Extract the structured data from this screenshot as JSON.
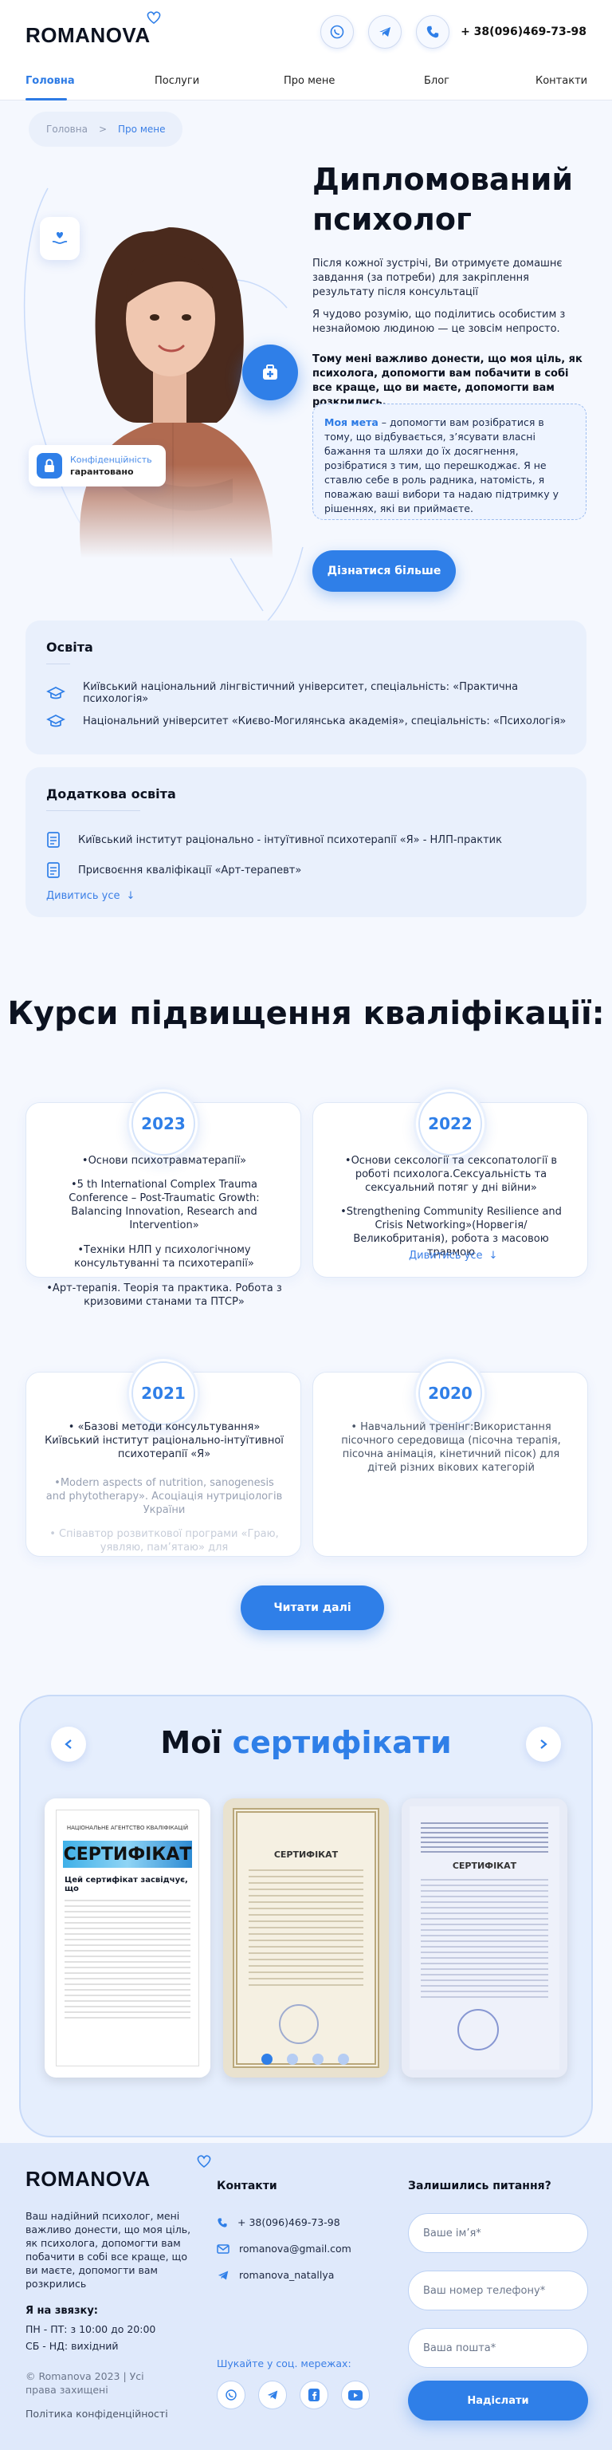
{
  "header": {
    "logo": "ROMANOVA",
    "phone": "+ 38(096)469-73-98",
    "icons": [
      "viber-icon",
      "telegram-icon",
      "phone-icon"
    ]
  },
  "nav": {
    "items": [
      "Головна",
      "Послуги",
      "Про мене",
      "Блог",
      "Контакти"
    ],
    "active": "Головна"
  },
  "breadcrumb": {
    "home": "Головна",
    "sep": ">",
    "current": "Про мене"
  },
  "hero": {
    "title": "Дипломований психолог",
    "p1": "Після кожної зустрічі, Ви отримуєте домашнє завдання (за потреби) для закріплення результату після консультації",
    "p2": "Я чудово розумію, що поділитись особистим з незнайомою людиною — це зовсім непросто.",
    "bold": "Тому мені важливо донести, що моя ціль, як психолога, допомогти вам побачити в собі все краще, що ви маєте, допомогти вам розкрились.",
    "goal_label": "Моя мета",
    "goal_text": " – допомогти вам розібратися в тому, що відбувається, з’ясувати власні бажання та шляхи до їх досягнення, розібратися з тим, що перешкоджає. Я не ставлю себе в роль радника, натомість, я поважаю ваші вибори та надаю підтримку у рішеннях, які ви приймаєте.",
    "badge_line1": "Конфіденційність",
    "badge_line2": "гарантовано",
    "cta": "Дізнатися більше"
  },
  "education": {
    "title": "Освіта",
    "items": [
      "Київський національний лінгвістичний університет, спеціальність: «Практична психологія»",
      "Національний університет «Києво-Могилянська академія», спеціальність: «Психологія»"
    ]
  },
  "extra": {
    "title": "Додаткова освіта",
    "items": [
      "Київський інститут раціонально - інтуїтивної психотерапії «Я» - НЛП-практик",
      "Присвоєння кваліфікації «Арт-терапевт»"
    ],
    "more": "Дивитись усе"
  },
  "courses": {
    "title": "Курси підвищення кваліфікації:",
    "y2023": {
      "year": "2023",
      "items": [
        "•Основи психотравматерапії»",
        "•5 th International Complex Trauma Conference – Post-Traumatic Growth: Balancing Innovation, Research and Intervention»",
        "•Техніки НЛП у психологічному консультуванні та психотерапії»",
        "•Арт-терапія. Теорія та практика. Робота з кризовими станами та ПТСР»"
      ]
    },
    "y2022": {
      "year": "2022",
      "items": [
        "•Основи сексології та сексопатології в роботі психолога.Сексуальність та сексуальний потяг у дні війни»",
        "•Strengthening Community Resilience and Crisis Networking»(Норвегія/ Великобританія), робота з масовою травмою"
      ],
      "more": "Дивитись усе"
    },
    "y2021": {
      "year": "2021",
      "items": [
        "• «Базові методи консультування» Київський інститут раціонально-інтуїтивної психотерапії «Я»",
        "•Modern aspects of nutrition, sanogenesis and phytotherapy». Асоціація нутриціологів України",
        "• Співавтор розвиткової програми «Граю, уявляю, пам’ятаю» для"
      ]
    },
    "y2020": {
      "year": "2020",
      "items": [
        "• Навчальний тренінг:Використання пісочного середовища (пісочна терапія, пісочна анімація, кінетичний пісок) для дітей різних вікових категорій"
      ]
    },
    "cta": "Читати далі"
  },
  "certificates": {
    "title_a": "Мої ",
    "title_b": "сертифікати",
    "cert1_head": "НАЦІОНАЛЬНЕ АГЕНТСТВО КВАЛІФІКАЦІЙ",
    "cert1_title": "СЕРТИФІКАТ",
    "cert1_sub": "Цей сертифікат засвідчує, що",
    "cert2_title": "СЕРТИФІКАТ",
    "cert3_title": "СЕРТИФІКАТ"
  },
  "footer": {
    "logo": "ROMANOVA",
    "about": "Ваш надійний психолог, мені важливо донести, що моя ціль, як психолога, допомогти вам побачити в собі все краще, що ви маєте, допомогти вам розкрились",
    "hours_title": "Я на звязку:",
    "hours1": "ПН - ПТ: з 10:00 до 20:00",
    "hours2": "СБ - НД: вихідний",
    "copyright": "© Romanova 2023 | Усі права захищені",
    "privacy": "Політика конфіденційності",
    "contacts_title": "Контакти",
    "phone": "+ 38(096)469-73-98",
    "email": "romanova@gmail.com",
    "telegram": "romanova_natallya",
    "social_title": "Шукайте у соц. мережах:",
    "form_title": "Залишились питання?",
    "ph_name": "Ваше ім’я*",
    "ph_phone": "Ваш номер телефону*",
    "ph_email": "Ваша пошта*",
    "submit": "Надіслати"
  },
  "colors": {
    "accent": "#2f7fe8",
    "bg": "#f5f8fe",
    "card": "#e9f0fc",
    "footer": "#dfe9fb"
  }
}
